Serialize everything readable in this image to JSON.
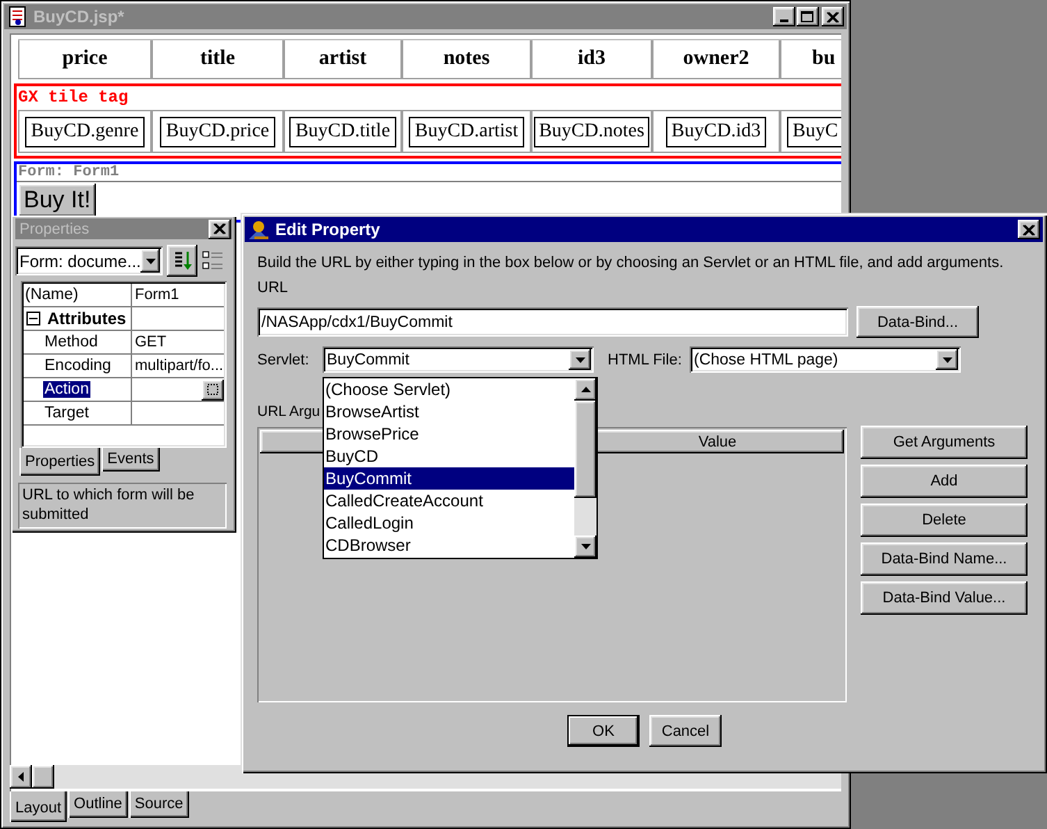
{
  "main_window": {
    "title": "BuyCD.jsp*",
    "header_cells": [
      "price",
      "title",
      "artist",
      "notes",
      "id3",
      "owner2",
      "bu"
    ],
    "tile_tag": "GX tile tag",
    "tile_cells": [
      "BuyCD.genre",
      "BuyCD.price",
      "BuyCD.title",
      "BuyCD.artist",
      "BuyCD.notes",
      "BuyCD.id3",
      "BuyC"
    ],
    "form_label": "Form: Form1",
    "form_button": "Buy It!",
    "view_tabs": [
      {
        "label": "Layout",
        "selected": true
      },
      {
        "label": "Outline",
        "selected": false
      },
      {
        "label": "Source",
        "selected": false
      }
    ]
  },
  "properties_panel": {
    "title": "Properties",
    "object_select": "Form: docume...",
    "rows": [
      {
        "kind": "property",
        "name": "(Name)",
        "value": "Form1",
        "selected": false
      },
      {
        "kind": "group",
        "name": "Attributes",
        "expanded": true,
        "children": [
          {
            "kind": "property",
            "name": "Method",
            "value": "GET",
            "selected": false
          },
          {
            "kind": "property",
            "name": "Encoding",
            "value": "multipart/fo...",
            "selected": false
          },
          {
            "kind": "property",
            "name": "Action",
            "selected": true
          },
          {
            "kind": "property",
            "name": "Target",
            "selected": false
          }
        ]
      }
    ],
    "tabs": [
      {
        "label": "Properties",
        "selected": true
      },
      {
        "label": "Events",
        "selected": false
      }
    ],
    "description": "URL to which form will be submitted"
  },
  "edit_property_dialog": {
    "title": "Edit Property",
    "instructions": "Build the URL by either typing in the box below or by choosing an Servlet or an HTML file, and add arguments.",
    "url_label": "URL",
    "url_value": "/NASApp/cdx1/BuyCommit",
    "data_bind_button": "Data-Bind...",
    "servlet_label": "Servlet:",
    "servlet_value": "BuyCommit",
    "html_file_label": "HTML File:",
    "html_file_value": "(Chose HTML page)",
    "servlet_options": [
      {
        "label": "(Choose Servlet)",
        "selected": false
      },
      {
        "label": "BrowseArtist",
        "selected": false
      },
      {
        "label": "BrowsePrice",
        "selected": false
      },
      {
        "label": "BuyCD",
        "selected": false
      },
      {
        "label": "BuyCommit",
        "selected": true
      },
      {
        "label": "CalledCreateAccount",
        "selected": false
      },
      {
        "label": "CalledLogin",
        "selected": false
      },
      {
        "label": "CDBrowser",
        "selected": false
      }
    ],
    "arguments_label": "URL Argu",
    "value_column": "Value",
    "side_buttons": [
      "Get Arguments",
      "Add",
      "Delete",
      "Data-Bind Name...",
      "Data-Bind Value..."
    ],
    "buttons": [
      "OK",
      "Cancel"
    ]
  }
}
